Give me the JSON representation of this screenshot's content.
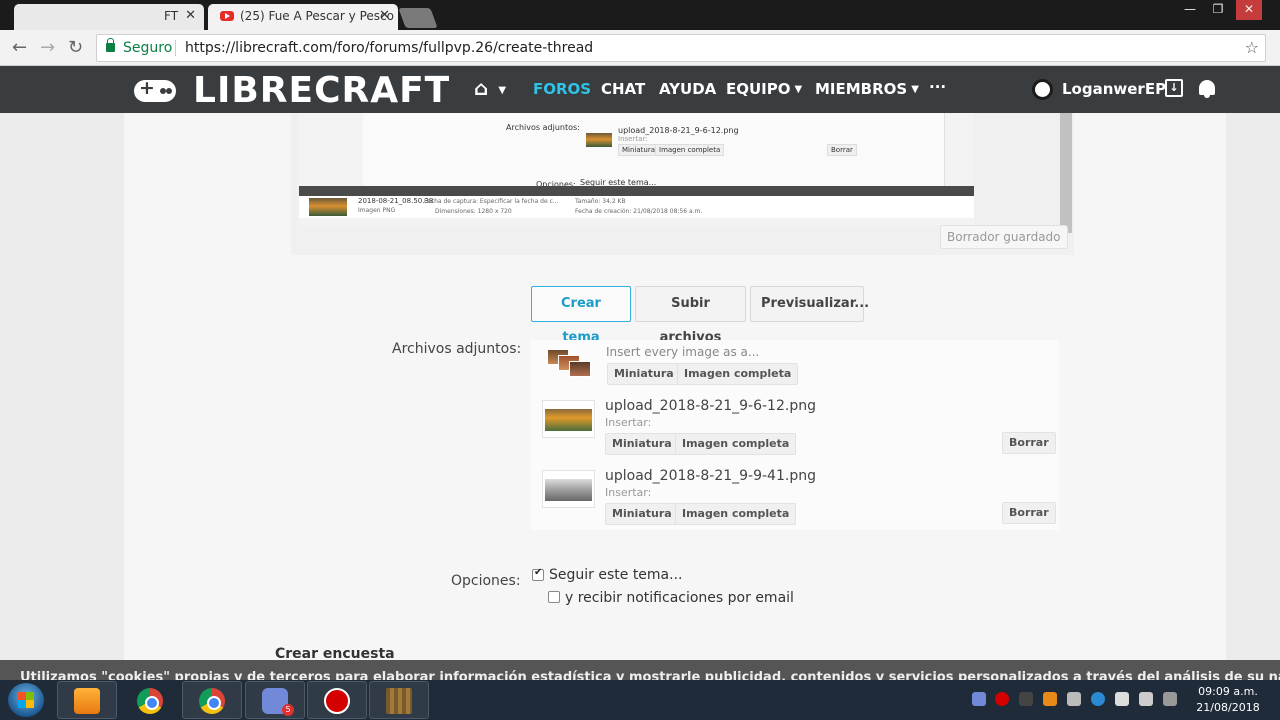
{
  "browser": {
    "tabs": [
      {
        "label": "FT"
      },
      {
        "label": "(25) Fue A Pescar y Pesco"
      }
    ],
    "close_glyph": "✕",
    "nav_back": "←",
    "nav_forward": "→",
    "nav_reload": "↻",
    "secure_label": "Seguro",
    "url": "https://librecraft.com/foro/forums/fullpvp.26/create-thread",
    "window_controls": [
      "—",
      "❐",
      "✕"
    ],
    "star_glyph": "☆"
  },
  "site": {
    "logo": "LIBRECRAFT",
    "nav": {
      "home_glyph": "⌂",
      "items": [
        "FOROS",
        "CHAT",
        "AYUDA",
        "EQUIPO",
        "MIEMBROS"
      ],
      "more": "···",
      "caret": "▼"
    },
    "username": "LoganwerEP",
    "inbox_glyph": "↓"
  },
  "snapshot": {
    "attachments_label": "Archivos adjuntos:",
    "file": "upload_2018-8-21_9-6-12.png",
    "insert": "Insertar:",
    "thumb": "Miniatura",
    "full": "Imagen completa",
    "delete": "Borrar",
    "options": "Opciones:",
    "follow": "Seguir este tema...",
    "file_info": {
      "name": "2018-08-21_08.50.38",
      "type": "Imagen PNG",
      "captured": "Fecha de captura: Especificar la fecha de c...",
      "dims": "Dimensiones: 1280 x 720",
      "size": "Tamaño: 34,2 KB",
      "created": "Fecha de creación: 21/08/2018 08:56 a.m."
    }
  },
  "editor": {
    "draft_saved": "Borrador guardado",
    "scroll_arrow": "▼"
  },
  "actions": {
    "create": "Crear tema",
    "upload": "Subir archivos",
    "preview": "Previsualizar..."
  },
  "attachments": {
    "label": "Archivos adjuntos:",
    "insert_all": "Insert every image as a...",
    "thumb_label": "Miniatura",
    "full_label": "Imagen completa",
    "delete_label": "Borrar",
    "insert_label": "Insertar:",
    "files": [
      {
        "name": "upload_2018-8-21_9-6-12.png"
      },
      {
        "name": "upload_2018-8-21_9-9-41.png"
      }
    ]
  },
  "options": {
    "label": "Opciones:",
    "follow": "Seguir este tema...",
    "follow_checked": true,
    "email": "y recibir notificaciones por email",
    "email_checked": false
  },
  "poll": {
    "label": "Crear encuesta"
  },
  "cookie": {
    "text": "Utilizamos \"cookies\" propias y de terceros para elaborar información estadística y mostrarle publicidad, contenidos y servicios personalizados a través del análisis de su navegación. S"
  },
  "taskbar": {
    "discord_badge": "5",
    "time": "09:09 a.m.",
    "date": "21/08/2018"
  },
  "colors": {
    "accent": "#2fc3e8",
    "nav_bg": "#3a3d3f",
    "taskbar": "#1f2b38"
  }
}
